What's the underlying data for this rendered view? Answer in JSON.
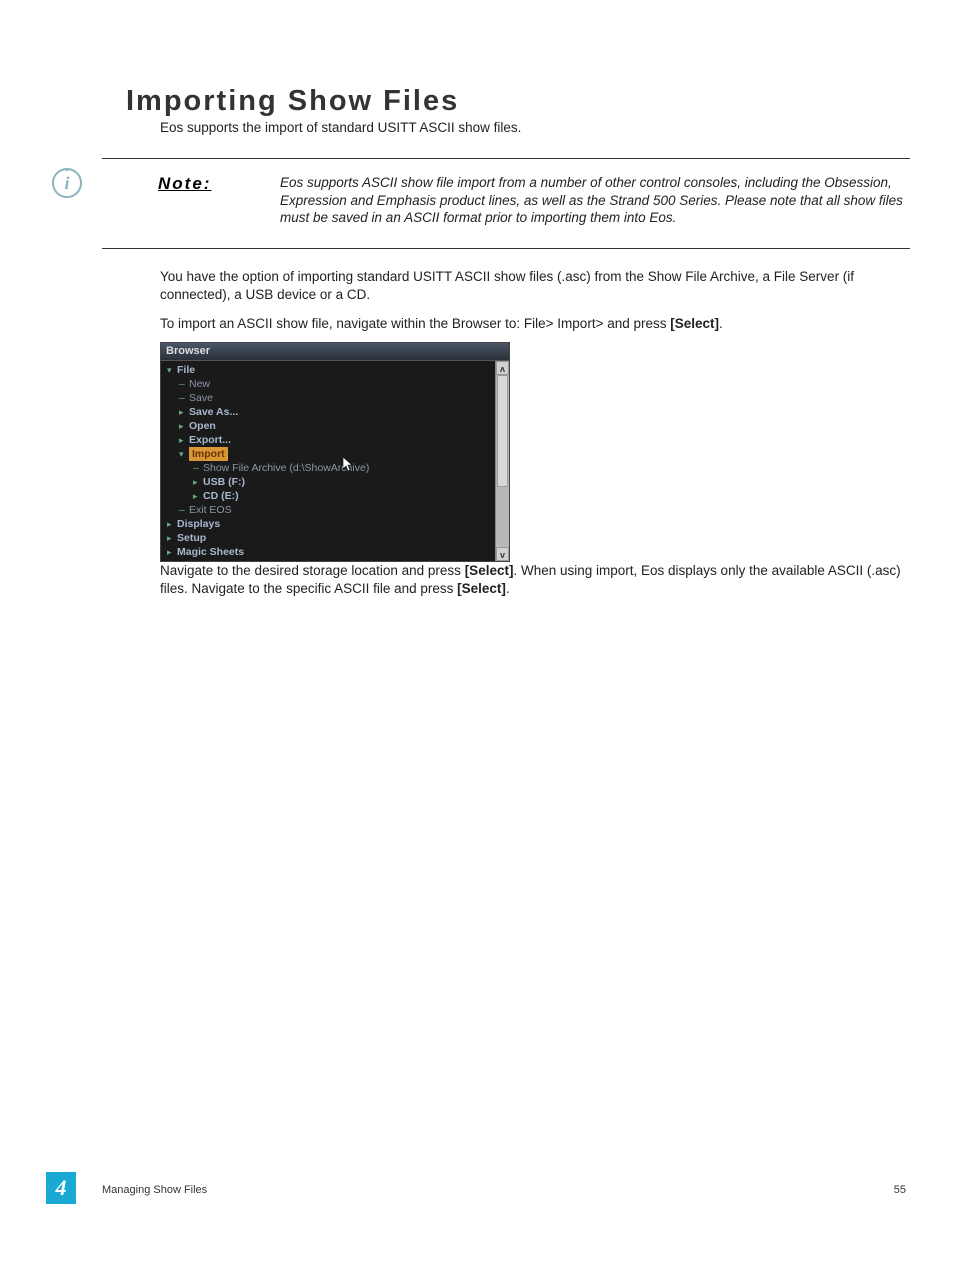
{
  "heading": "Importing Show Files",
  "intro": "Eos supports the import of standard USITT ASCII show files.",
  "note_label": "Note:",
  "note_body": "Eos supports ASCII show file import from a number of other control consoles, including the Obsession, Expression and Emphasis product lines, as well as the Strand 500 Series. Please note that all show files must be saved in an ASCII format prior to importing them into Eos.",
  "para1": "You have the option of importing standard USITT ASCII show files (.asc) from the Show File Archive, a File Server (if connected), a USB device or a CD.",
  "para2_pre": "To import an ASCII show file, navigate within the Browser to: File> Import> and press ",
  "select_label": "[Select]",
  "period": ".",
  "browser": {
    "title": "Browser",
    "items": {
      "file": "File",
      "new": "New",
      "save": "Save",
      "save_as": "Save As...",
      "open": "Open",
      "export": "Export...",
      "import": "Import",
      "archive": "Show File Archive (d:\\ShowArchive)",
      "usb": "USB (F:)",
      "cd": "CD (E:)",
      "exit": "Exit EOS",
      "displays": "Displays",
      "setup": "Setup",
      "magic": "Magic Sheets"
    },
    "scroll_up": "ʌ",
    "scroll_down": "v"
  },
  "para3_a": "Navigate to the desired storage location and press ",
  "para3_b": ". When using import, Eos displays only the available ASCII (.asc) files. Navigate to the specific ASCII file and press ",
  "chapter_number": "4",
  "footer": "Managing Show Files",
  "page_num": "55"
}
